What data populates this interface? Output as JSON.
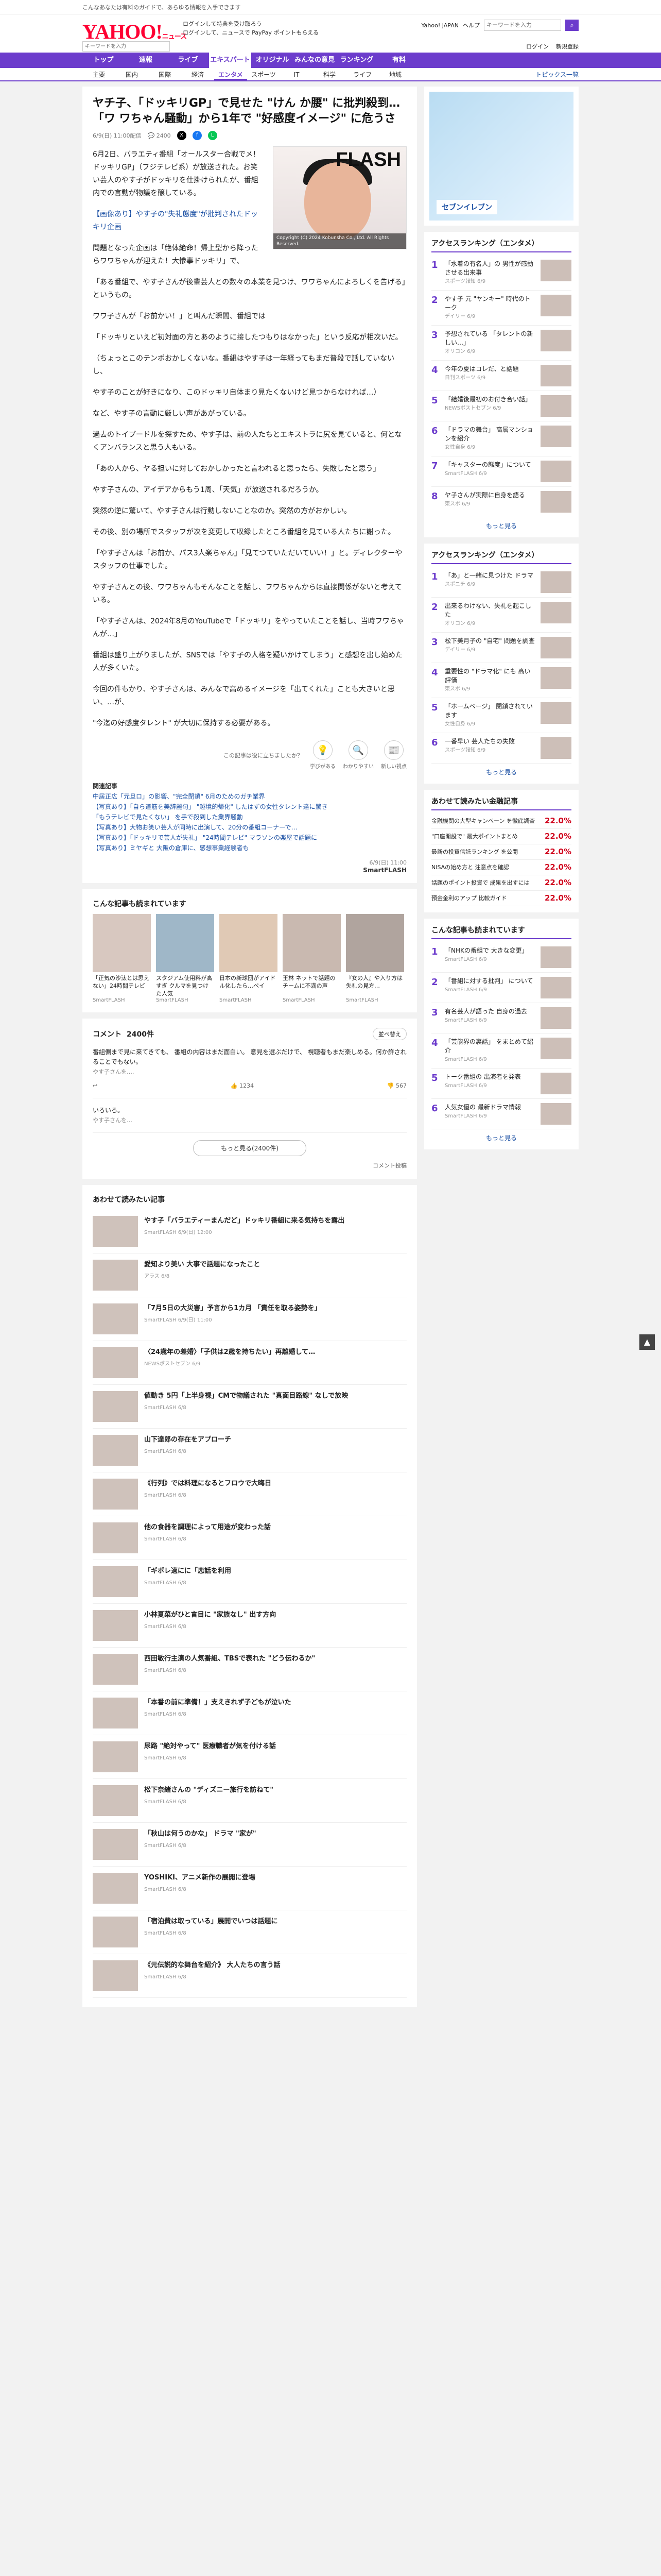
{
  "promo": {
    "text": "こんなあなたは有料のガイドで、あらゆる情報を入手できます"
  },
  "header": {
    "logo": "YAHOO!",
    "logo_sub": "ニュース",
    "links": [
      "ログインして特典を受け取ろう",
      "ログインして、ニュースで PayPay ポイントもらえる"
    ],
    "top_right": [
      "Yahoo! JAPAN",
      "ヘルプ"
    ],
    "search_placeholder": "キーワードを入力",
    "search_placeholder2": "キーワードを入力",
    "row2": [
      "ログイン",
      "新規登録"
    ]
  },
  "nav": {
    "items": [
      "トップ",
      "速報",
      "ライブ",
      "エキスパート",
      "オリジナル",
      "みんなの意見",
      "ランキング",
      "有料"
    ],
    "active": 3
  },
  "subnav": {
    "items": [
      "主要",
      "国内",
      "国際",
      "経済",
      "エンタメ",
      "スポーツ",
      "IT",
      "科学",
      "ライフ",
      "地域"
    ],
    "active": 4,
    "right": "トピックス一覧"
  },
  "article": {
    "title": "ヤチ子、「ドッキリGP」で見せた \"けん か腰\" に批判殺到…「ワ ワちゃん騒動」から1年で \"好感度イメージ\" に危うさ",
    "date": "6/9(日) 11:00配信",
    "comments": "2400",
    "photo_caption": "Copyright (C) 2024 Kobunsha Co., Ltd. All Rights Reserved.",
    "photo_brand": "FLASH",
    "paragraphs": [
      "6月2日、バラエティ番組「オールスター合戦でメ！ドッキリGP」（フジテレビ系）が放送された。お笑い芸人のやす子がドッキリを仕掛けられたが、番組内での言動が物議を醸している。",
      "【画像あり】やす子の\"失礼態度\"が批判されたドッキリ企画",
      "問題となった企画は「絶体絶命！帰上型から降ったらワワちゃんが迎えた！大惨事ドッキリ」で、",
      "「ある番組で、やす子さんが後輩芸人との数々の本業を見つけ、ワワちゃんによろしくを告げる」というもの。",
      "ワワ子さんが「お前かい！」と叫んだ瞬間、番組では",
      "「ドッキリといえど初対面の方とあのように接したつもりはなかった」という反応が相次いだ。",
      "（ちょっとこのテンポおかしくないな。番組はやす子は一年経ってもまだ普段で話していないし、",
      "やす子のことが好きになり、このドッキリ自体まり見たくないけど見つからなければ…）",
      "など、やす子の言動に厳しい声があがっている。",
      "過去のトイプードルを探すため、やす子は、前の人たちとエキストラに尻を見ていると、何となくアンバランスと思う人もいる。",
      "「あの人から、ヤる担いに対しておかしかったと言われると思ったら、失敗したと思う」",
      "やす子さんの、アイデアからもう1周、「天気」が放送されるだろうか。",
      "突然の逆に驚いて、やす子さんは行動しないことなのか。突然の方がおかしい。",
      "その後、別の場所でスタッフが次を変更して収録したところ番組を見ている人たちに謝った。",
      "「やす子さんは「お前か、パス3人楽ちゃん」「見てつていただいていい！」と。ディレクターやスタッフの仕事でした。",
      "やす子さんとの後、ワワちゃんもそんなことを話し、フワちゃんからは直接関係がないと考えている。",
      "「やす子さんは、2024年8月のYouTubeで「ドッキリ」をやっていたことを話し、当時フワちゃんが…」",
      "番組は盛り上がりましたが、SNSでは「やす子の人格を疑いかけてしまう」と感想を出し始めた人が多くいた。",
      "今回の件もかり、やす子さんは、みんなで高めるイメージを「出てくれた」ことも大きいと思い、…が、",
      "\"今迄の好感度タレント\" が大切に保持する必要がある。"
    ],
    "reactions": [
      {
        "icon": "💡",
        "label": "学びがある"
      },
      {
        "icon": "🔍",
        "label": "わかりやすい"
      },
      {
        "icon": "📰",
        "label": "新しい視点"
      }
    ],
    "reaction_note": "この記事は役に立ちましたか？",
    "related_header": "関連記事",
    "related": [
      "中居正広「元旦ロ」の影響、\"完全閉鎖\" 6月のためのガチ業界",
      "【写真あり】「自ら道筋を美辞麗句」 \"越境的帰化\" したはずの女性タレント達に驚き",
      "「もうテレビで見たくない」 を手で殺到した業界騒動",
      "【写真あり】大物お笑い芸人が同時に出演して、20分の番組コーナーで…",
      "【写真あり】「ドッキリで芸人が失礼」 \"24時間テレビ\" マラソンの楽屋で話題に",
      "【写真あり】ミヤギと 大阪の倉庫に、感想事業経験者も"
    ],
    "source_date": "6/9(日) 11:00",
    "source_name": "SmartFLASH"
  },
  "readers": {
    "title": "こんな記事も読まれています",
    "items": [
      {
        "cap": "「正気の沙汰とは思えない」24時間テレビ",
        "by": "SmartFLASH"
      },
      {
        "cap": "スタジアム使用料が高すぎ クルマを見つけた人気",
        "by": "SmartFLASH"
      },
      {
        "cap": "日本の新球団がアイドル化したら…ペイ",
        "by": "SmartFLASH"
      },
      {
        "cap": "王林 ネットで話題のチームに不満の声",
        "by": "SmartFLASH"
      },
      {
        "cap": "『女の人』や入り方は失礼の見方…",
        "by": "SmartFLASH"
      }
    ]
  },
  "comments": {
    "title": "コメント",
    "count": "2400件",
    "sort": "並べ替え",
    "list": [
      {
        "text": "番組側まで見に来てきても、 番組の内容はまだ面白い。 意見を選ぶだけで、 視聴者もまだ楽しめる。何か許されることでもない。",
        "by": "やす子さんを….",
        "likes": "1234",
        "dislikes": "567"
      },
      {
        "text": "いろいろ。",
        "by": "やす子さんを…",
        "likes": "",
        "dislikes": ""
      }
    ],
    "more": "もっと見る(2400件)",
    "policy": "コメント投稿"
  },
  "recommend": {
    "title": "あわせて読みたい記事",
    "items": [
      {
        "t": "やす子「バラエティーまんだど」ドッキリ番組に来る気持ちを露出",
        "s": "SmartFLASH 6/9(日) 12:00"
      },
      {
        "t": "愛知より美い 大事で話題になったこと",
        "s": "アラス 6/8"
      },
      {
        "t": "「7月5日の大災害」予言から1カ月 「責任を取る姿勢を」",
        "s": "SmartFLASH 6/9(日) 11:00"
      },
      {
        "t": "〈24歳年の差婚〉「子供は2歳を持ちたい」再離婚して…",
        "s": "NEWSポストセブン 6/9"
      },
      {
        "t": "値動き 5円「上半身裸」CMで物議された \"真面目路線\" なしで放映",
        "s": "SmartFLASH 6/8"
      },
      {
        "t": "山下達郎の存在をアプローチ",
        "s": "SmartFLASH 6/8"
      },
      {
        "t": "《行列》では料理になるとフロウで大晦日",
        "s": "SmartFLASH 6/8"
      },
      {
        "t": "他の食器を調理によって用途が変わった話",
        "s": "SmartFLASH 6/8"
      },
      {
        "t": "「ギボレ適にに「恋話を利用",
        "s": "SmartFLASH 6/8"
      },
      {
        "t": "小林夏菜がひと言目に \"家族なし\" 出す方向",
        "s": "SmartFLASH 6/8"
      },
      {
        "t": "西田敏行主演の人気番組、TBSで表れた \"どう伝わるか\"",
        "s": "SmartFLASH 6/8"
      },
      {
        "t": "「本番の前に準備！」支えきれず子どもが泣いた",
        "s": "SmartFLASH 6/8"
      },
      {
        "t": "尿路 \"絶対やって\" 医療職者が気を付ける話",
        "s": "SmartFLASH 6/8"
      },
      {
        "t": "松下奈緒さんの \"ディズニー旅行を訪ねて\"",
        "s": "SmartFLASH 6/8"
      },
      {
        "t": "「秋山は何うのかな」 ドラマ \"家が\"",
        "s": "SmartFLASH 6/8"
      },
      {
        "t": "YOSHIKI、アニメ新作の展開に登場",
        "s": "SmartFLASH 6/8"
      },
      {
        "t": "「宿泊費は取っている」展開でいつは話題に",
        "s": "SmartFLASH 6/8"
      },
      {
        "t": "《元伝説的な舞台を紹介》 大人たちの言う話",
        "s": "SmartFLASH 6/8"
      }
    ]
  },
  "side": {
    "ad_label": "セブンイレブン",
    "access_title": "アクセスランキング（エンタメ）",
    "access": [
      {
        "t": "「水着の有名人」の 男性が感動させる出来事",
        "s": "スポーツ報知 6/9"
      },
      {
        "t": "やす子 元 \"ヤンキー\" 時代のトーク",
        "s": "デイリー 6/9"
      },
      {
        "t": "予想されている 「タレントの新 しい…」",
        "s": "オリコン 6/9"
      },
      {
        "t": "今年の夏はコレだ、と話題",
        "s": "日刊スポーツ 6/9"
      },
      {
        "t": "「結婚後最初のお付き合い話」",
        "s": "NEWSポストセブン 6/9"
      },
      {
        "t": "「ドラマの舞台」 高層マンションを紹介",
        "s": "女性自身 6/9"
      },
      {
        "t": "「キャスターの態度」について",
        "s": "SmartFLASH 6/9"
      },
      {
        "t": "ヤ子さんが実際に自身を語る",
        "s": "東スポ 6/9"
      }
    ],
    "access2_title": "アクセスランキング（エンタメ）",
    "access2": [
      {
        "t": "「あ」と一緒に見つけた ドラマ",
        "s": "スポニチ 6/9"
      },
      {
        "t": "出来るわけない、失礼を起こした",
        "s": "オリコン 6/9"
      },
      {
        "t": "松下美月子の \"自宅\" 問題を調査",
        "s": "デイリー 6/9"
      },
      {
        "t": "重要性の \"ドラマ化\" にも 高い評価",
        "s": "東スポ 6/9"
      },
      {
        "t": "「ホームページ」 閉鎖されています",
        "s": "女性自身 6/9"
      },
      {
        "t": "一番早い 芸人たちの失敗",
        "s": "スポーツ報知 6/9"
      }
    ],
    "fin_title": "あわせて読みたい金融記事",
    "fin": [
      {
        "t": "金融機関の大型キャンペーン を徹底調査",
        "p": "22.0%"
      },
      {
        "t": "\"口座開設で\" 最大ポイントまとめ",
        "p": "22.0%"
      },
      {
        "t": "最新の投資信託ランキング を公開",
        "p": "22.0%"
      },
      {
        "t": "NISAの始め方と 注意点を確認",
        "p": "22.0%"
      },
      {
        "t": "話題のポイント投資で 成果を出すには",
        "p": "22.0%"
      },
      {
        "t": "預金金利のアップ 比較ガイド",
        "p": "22.0%"
      }
    ],
    "related_title": "こんな記事も読まれています",
    "rel": [
      {
        "t": "「NHKの番組で 大きな変更」",
        "s": "SmartFLASH 6/9"
      },
      {
        "t": "「番組に対する批判」 について",
        "s": "SmartFLASH 6/9"
      },
      {
        "t": "有名芸人が語った 自身の過去",
        "s": "SmartFLASH 6/9"
      },
      {
        "t": "「芸能界の裏話」 をまとめて紹介",
        "s": "SmartFLASH 6/9"
      },
      {
        "t": "トーク番組の 出演者を発表",
        "s": "SmartFLASH 6/9"
      },
      {
        "t": "人気女優の 最新ドラマ情報",
        "s": "SmartFLASH 6/9"
      }
    ],
    "more": "もっと見る"
  }
}
